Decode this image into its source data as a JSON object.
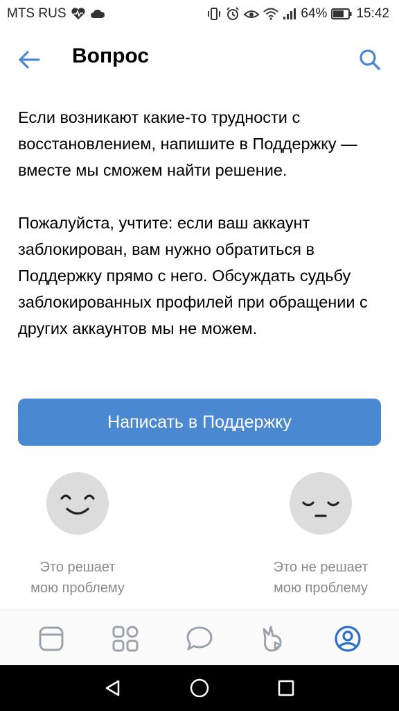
{
  "status_bar": {
    "carrier": "MTS RUS",
    "battery_percent": "64%",
    "time": "15:42"
  },
  "header": {
    "title": "Вопрос",
    "back_icon": "arrow-left-icon",
    "search_icon": "search-icon"
  },
  "content": {
    "paragraph_1": "Если возникают какие-то трудности с восстановлением, напишите в Поддержку — вместе мы сможем найти решение.",
    "paragraph_2": "Пожалуйста, учтите: если ваш аккаунт заблокирован, вам нужно обратиться в Поддержку прямо с него. Обсуждать судьбу заблокированных профилей при обращении с других аккаунтов мы не можем."
  },
  "support_button": {
    "label": "Написать в Поддержку"
  },
  "feedback": {
    "positive": {
      "line1": "Это решает",
      "line2": "мою проблему",
      "icon": "smiling-face-icon"
    },
    "negative": {
      "line1": "Это не решает",
      "line2": "мою проблему",
      "icon": "sad-face-icon"
    }
  },
  "tab_bar": {
    "items": [
      {
        "icon": "news-icon"
      },
      {
        "icon": "services-icon"
      },
      {
        "icon": "messages-icon"
      },
      {
        "icon": "clips-icon"
      },
      {
        "icon": "profile-icon",
        "active": true
      }
    ]
  },
  "colors": {
    "accent": "#4a88d1",
    "icon_gray": "#9aa3ad",
    "face_bg": "#dcdcdc"
  }
}
